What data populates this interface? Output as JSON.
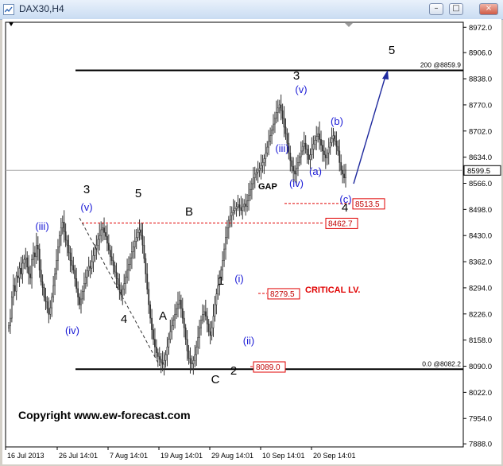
{
  "window": {
    "title": "DAX30,H4",
    "minimize_glyph": "–",
    "maximize_glyph": "□",
    "close_glyph": "×"
  },
  "chart_data": {
    "type": "candlestick",
    "symbol": "DAX30",
    "timeframe": "H4",
    "y_ticks": [
      8972.0,
      8906.0,
      8838.0,
      8770.0,
      8702.0,
      8634.0,
      8566.0,
      8498.0,
      8430.0,
      8362.0,
      8294.0,
      8226.0,
      8158.0,
      8090.0,
      8022.0,
      7954.0,
      7888.0
    ],
    "ylim": [
      7880,
      8990
    ],
    "x_ticks": [
      "16 Jul 2013",
      "26 Jul 14:01",
      "7 Aug 14:01",
      "19 Aug 14:01",
      "29 Aug 14:01",
      "10 Sep 14:01",
      "20 Sep 14:01"
    ],
    "current_price": "8599.5",
    "fib_levels": [
      {
        "label": "200  @8859.9",
        "value": 8859.9
      },
      {
        "label": "0.0  @8082.2",
        "value": 8082.2
      }
    ],
    "price_tags": [
      {
        "label": "8513.5",
        "value": 8513.5
      },
      {
        "label": "8462.7",
        "value": 8462.7
      },
      {
        "label": "8279.5",
        "value": 8279.5
      },
      {
        "label": "8089.0",
        "value": 8089.0
      }
    ],
    "wave_labels_black": [
      "3",
      "5",
      "4",
      "B",
      "A",
      "1",
      "2",
      "C",
      "3",
      "4",
      "5"
    ],
    "wave_labels_blue": [
      "(iii)",
      "(v)",
      "(iv)",
      "(i)",
      "(ii)",
      "(iii)",
      "(iv)",
      "(v)",
      "(a)",
      "(b)",
      "(c)"
    ],
    "annotations": {
      "gap": "GAP",
      "critical": "CRITICAL LV.",
      "copyright": "Copyright www.ew-forecast.com"
    },
    "closes": [
      8195,
      8215,
      8270,
      8300,
      8285,
      8325,
      8320,
      8345,
      8330,
      8358,
      8368,
      8372,
      8348,
      8330,
      8320,
      8368,
      8385,
      8375,
      8405,
      8395,
      8340,
      8310,
      8295,
      8270,
      8258,
      8240,
      8225,
      8242,
      8270,
      8300,
      8330,
      8365,
      8400,
      8430,
      8450,
      8465,
      8440,
      8418,
      8405,
      8385,
      8365,
      8352,
      8340,
      8318,
      8292,
      8270,
      8250,
      8265,
      8285,
      8305,
      8322,
      8338,
      8350,
      8345,
      8362,
      8378,
      8395,
      8405,
      8420,
      8430,
      8445,
      8450,
      8438,
      8428,
      8410,
      8392,
      8375,
      8365,
      8352,
      8335,
      8318,
      8302,
      8288,
      8275,
      8290,
      8305,
      8322,
      8340,
      8355,
      8372,
      8388,
      8400,
      8415,
      8425,
      8438,
      8445,
      8430,
      8405,
      8370,
      8330,
      8290,
      8250,
      8215,
      8185,
      8160,
      8140,
      8125,
      8115,
      8108,
      8100,
      8095,
      8105,
      8120,
      8140,
      8160,
      8180,
      8195,
      8210,
      8225,
      8240,
      8252,
      8262,
      8240,
      8215,
      8190,
      8160,
      8130,
      8110,
      8098,
      8096,
      8105,
      8120,
      8140,
      8165,
      8190,
      8210,
      8225,
      8232,
      8220,
      8200,
      8180,
      8170,
      8190,
      8220,
      8250,
      8278,
      8300,
      8320,
      8340,
      8365,
      8395,
      8425,
      8450,
      8470,
      8482,
      8490,
      8495,
      8500,
      8505,
      8510,
      8502,
      8495,
      8505,
      8512,
      8506,
      8520,
      8535,
      8550,
      8565,
      8580,
      8590,
      8595,
      8600,
      8605,
      8612,
      8620,
      8630,
      8645,
      8660,
      8675,
      8690,
      8705,
      8720,
      8735,
      8750,
      8762,
      8770,
      8755,
      8735,
      8712,
      8695,
      8670,
      8645,
      8625,
      8610,
      8598,
      8590,
      8605,
      8620,
      8635,
      8650,
      8662,
      8670,
      8655,
      8640,
      8628,
      8640,
      8655,
      8668,
      8678,
      8688,
      8695,
      8680,
      8665,
      8650,
      8640,
      8632,
      8645,
      8660,
      8672,
      8682,
      8690,
      8676,
      8662,
      8650,
      8620,
      8600,
      8590,
      8580,
      8600
    ]
  }
}
